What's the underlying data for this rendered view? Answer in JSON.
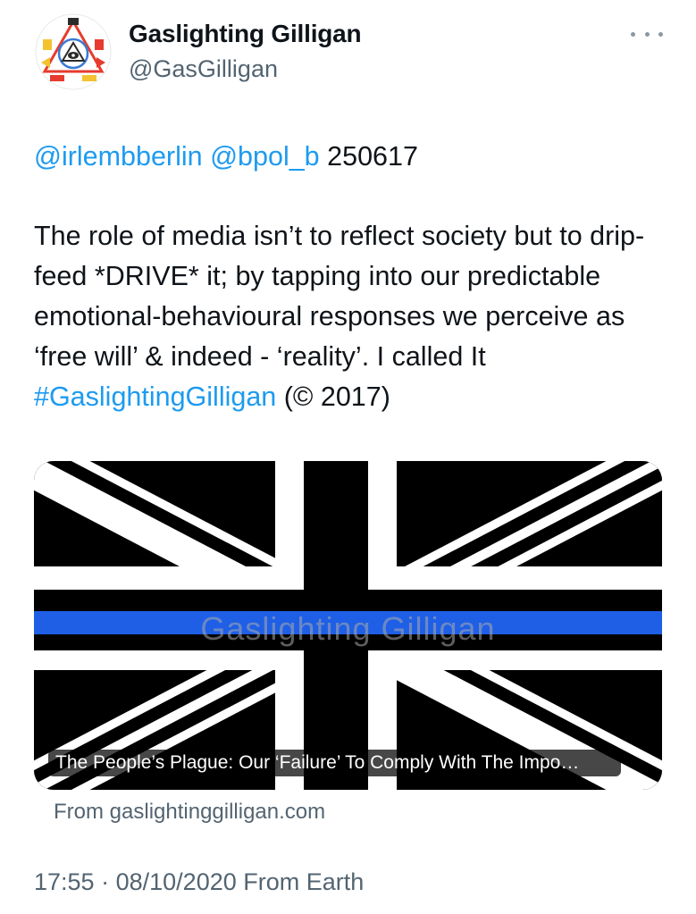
{
  "user": {
    "display_name": "Gaslighting Gilligan",
    "handle": "@GasGilligan",
    "avatar_icon": "gaslighting-gilligan-logo"
  },
  "menu": {
    "icon": "more-horizontal-icon"
  },
  "tweet": {
    "mention_1": "@irlembberlin",
    "mention_2": "@bpol_b",
    "code": "250617",
    "text_part1": "The role of media isn’t to reflect society but to drip-feed *DRIVE* it; by tapping into our predictable emotional-behavioural responses we perceive as ‘free will’ & indeed - ‘reality’. I called It ",
    "hashtag": "#GaslightingGilligan",
    "text_part2": " (© 2017)"
  },
  "card": {
    "watermark": "Gaslighting Gilligan",
    "title": "The People’s Plague: Our ‘Failure’ To Comply With The Impo…",
    "domain": "From gaslightinggilligan.com",
    "flag_colors": {
      "black": "#000000",
      "white": "#ffffff",
      "thin_blue_line": "#1f5fe6"
    }
  },
  "meta": {
    "time": "17:55",
    "separator": "·",
    "date": "08/10/2020",
    "source": "From Earth"
  },
  "colors": {
    "link": "#1d9bf0",
    "secondary": "#536471",
    "text": "#0f1419"
  }
}
